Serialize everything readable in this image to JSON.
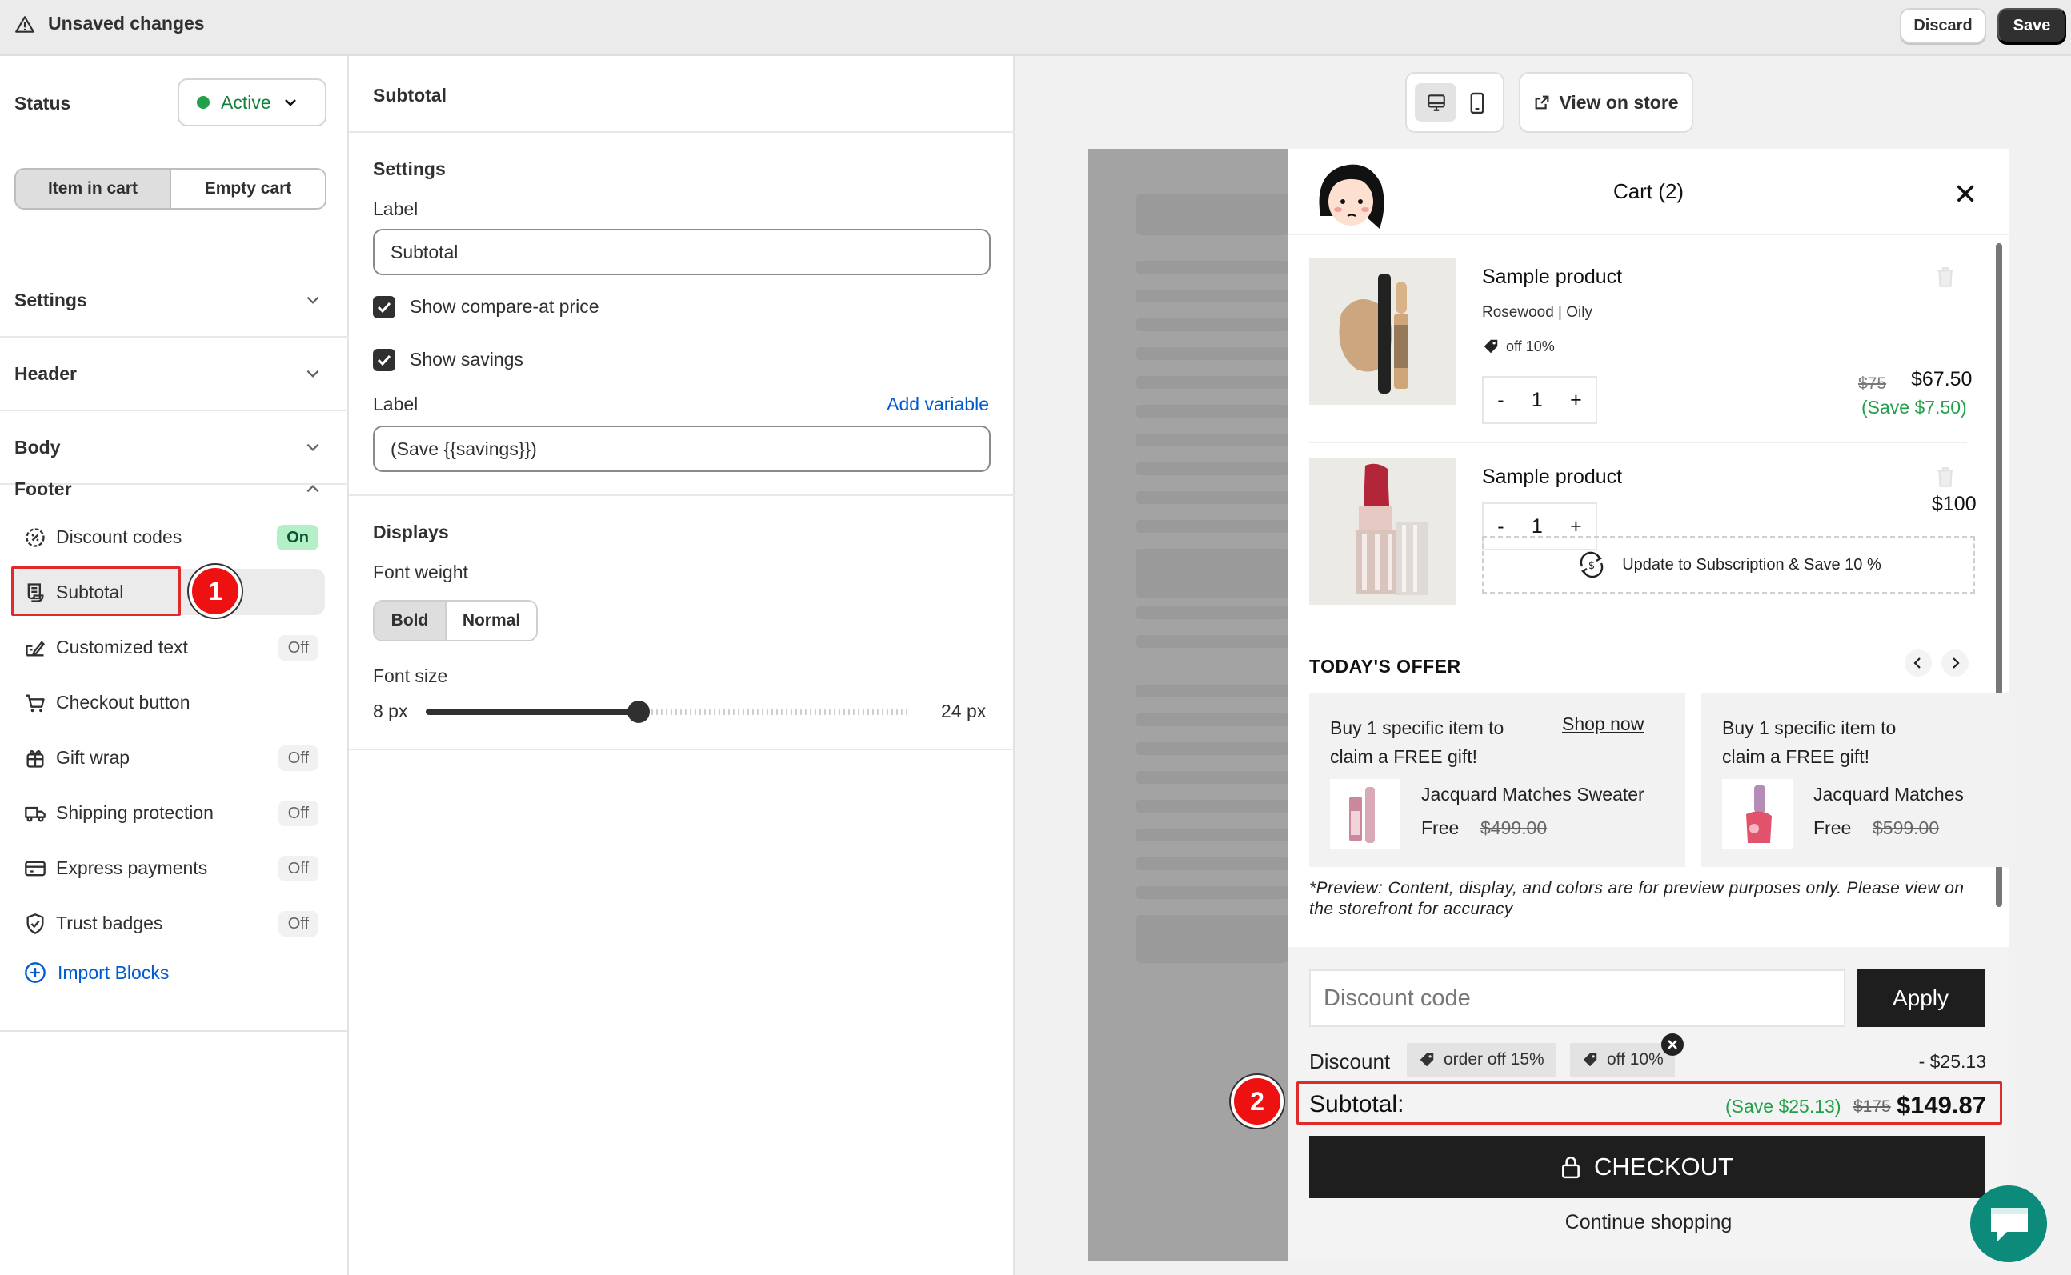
{
  "topbar": {
    "title": "Unsaved changes",
    "discard_label": "Discard",
    "save_label": "Save"
  },
  "sidebar": {
    "status_label": "Status",
    "status_value": "Active",
    "cart_state_tabs": [
      "Item in cart",
      "Empty cart"
    ],
    "sections": [
      "Settings",
      "Header",
      "Body"
    ],
    "footer_label": "Footer",
    "footer_items": [
      {
        "label": "Discount codes",
        "state": "On",
        "icon": "discount-gear-icon"
      },
      {
        "label": "Subtotal",
        "state": "",
        "icon": "receipt-icon"
      },
      {
        "label": "Customized text",
        "state": "Off",
        "icon": "text-edit-icon"
      },
      {
        "label": "Checkout button",
        "state": "",
        "icon": "cart-icon"
      },
      {
        "label": "Gift wrap",
        "state": "Off",
        "icon": "gift-icon"
      },
      {
        "label": "Shipping protection",
        "state": "Off",
        "icon": "truck-icon"
      },
      {
        "label": "Express payments",
        "state": "Off",
        "icon": "credit-card-icon"
      },
      {
        "label": "Trust badges",
        "state": "Off",
        "icon": "shield-check-icon"
      }
    ],
    "import_label": "Import Blocks",
    "markers": [
      "1",
      "2"
    ]
  },
  "editor": {
    "title": "Subtotal",
    "settings_heading": "Settings",
    "label_title": "Label",
    "label_value": "Subtotal",
    "show_compare_label": "Show compare-at price",
    "show_savings_label": "Show savings",
    "savings_label_title": "Label",
    "add_variable": "Add variable",
    "savings_label_value": "(Save {{savings}})",
    "displays_heading": "Displays",
    "font_weight_label": "Font weight",
    "font_weight_options": [
      "Bold",
      "Normal"
    ],
    "font_size_label": "Font size",
    "font_size_min": "8 px",
    "font_size_max": "24 px",
    "font_size_fraction": 0.44
  },
  "preview": {
    "view_on_store": "View on store",
    "cart_title": "Cart (2)",
    "items": [
      {
        "name": "Sample product",
        "variant": "Rosewood | Oily",
        "tag": "off 10%",
        "qty": "1",
        "compare": "$75",
        "price": "$67.50",
        "save": "(Save $7.50)"
      },
      {
        "name": "Sample product",
        "qty": "1",
        "price": "$100",
        "subscription": "Update to Subscription & Save 10 %"
      }
    ],
    "qty_minus": "-",
    "qty_plus": "+",
    "offer_title": "TODAY'S OFFER",
    "offers": [
      {
        "text": "Buy 1 specific item to claim a FREE gift!",
        "shop": "Shop now",
        "product": "Jacquard Matches Sweater",
        "free": "Free",
        "old": "$499.00"
      },
      {
        "text": "Buy 1 specific item to claim a FREE gift!",
        "product": "Jacquard Matches",
        "free": "Free",
        "old": "$599.00"
      }
    ],
    "note": "*Preview: Content, display, and colors are for preview purposes only. Please view on the storefront for accuracy",
    "discount_placeholder": "Discount code",
    "apply_label": "Apply",
    "discount_label": "Discount",
    "discount_tags": [
      "order off 15%",
      "off 10%"
    ],
    "discount_amount": "- $25.13",
    "subtotal_label": "Subtotal:",
    "subtotal_save": "(Save $25.13)",
    "subtotal_compare": "$175",
    "subtotal_value": "$149.87",
    "checkout_label": "CHECKOUT",
    "continue_label": "Continue shopping"
  },
  "colors": {
    "accent_green": "#22a04a",
    "link_blue": "#005bd3",
    "marker_red": "#e11111",
    "chat_teal": "#0c8b7a"
  }
}
